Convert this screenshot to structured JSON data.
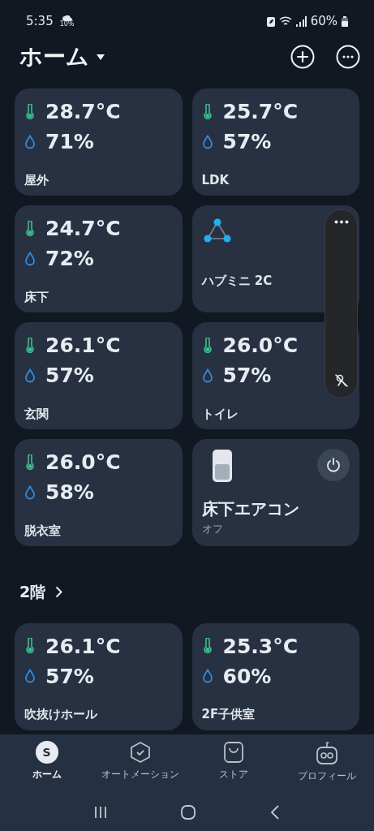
{
  "status_bar": {
    "time": "5:35",
    "weather_chance": "10%",
    "battery": "60%"
  },
  "header": {
    "title": "ホーム"
  },
  "cards": [
    {
      "kind": "sensor",
      "temperature": "28.7°C",
      "humidity": "71%",
      "name": "屋外"
    },
    {
      "kind": "sensor",
      "temperature": "25.7°C",
      "humidity": "57%",
      "name": "LDK"
    },
    {
      "kind": "sensor",
      "temperature": "24.7°C",
      "humidity": "72%",
      "name": "床下"
    },
    {
      "kind": "hub",
      "name": "ハブミニ 2C"
    },
    {
      "kind": "sensor",
      "temperature": "26.1°C",
      "humidity": "57%",
      "name": "玄関"
    },
    {
      "kind": "sensor",
      "temperature": "26.0°C",
      "humidity": "57%",
      "name": "トイレ"
    },
    {
      "kind": "sensor",
      "temperature": "26.0°C",
      "humidity": "58%",
      "name": "脱衣室"
    },
    {
      "kind": "device",
      "name": "床下エアコン",
      "status": "オフ",
      "on": false
    }
  ],
  "section": {
    "title": "2階",
    "cards": [
      {
        "kind": "sensor",
        "temperature": "26.1°C",
        "humidity": "57%",
        "name": "吹抜けホール"
      },
      {
        "kind": "sensor",
        "temperature": "25.3°C",
        "humidity": "60%",
        "name": "2F子供室"
      }
    ]
  },
  "tabs": [
    {
      "kind": "home",
      "label": "ホーム",
      "icon_letter": "S",
      "selected": true
    },
    {
      "kind": "automation",
      "label": "オートメーション",
      "selected": false
    },
    {
      "kind": "store",
      "label": "ストア",
      "selected": false
    },
    {
      "kind": "profile",
      "label": "プロフィール",
      "selected": false
    }
  ]
}
